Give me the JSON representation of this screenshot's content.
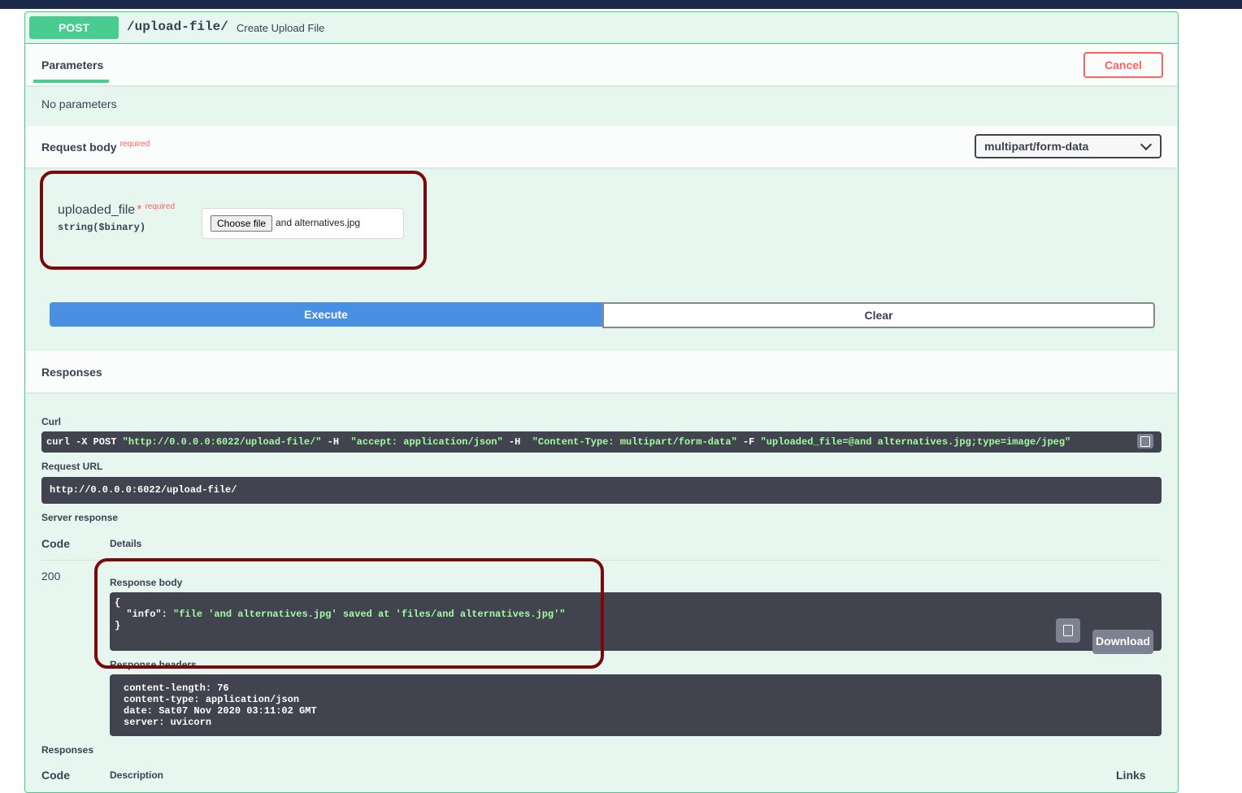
{
  "operation": {
    "method": "POST",
    "path": "/upload-file/",
    "summary": "Create Upload File"
  },
  "parameters": {
    "tab_label": "Parameters",
    "cancel_label": "Cancel",
    "empty_text": "No parameters"
  },
  "request_body": {
    "title": "Request body",
    "required_label": "required",
    "content_type": "multipart/form-data",
    "field": {
      "name": "uploaded_file",
      "star": "*",
      "required_label": "required",
      "type": "string($binary)",
      "choose_label": "Choose file",
      "file_name": "and alternatives.jpg"
    }
  },
  "actions": {
    "execute_label": "Execute",
    "clear_label": "Clear"
  },
  "responses_header": "Responses",
  "curl": {
    "label": "Curl",
    "cmd1": "curl -X POST ",
    "url": "\"http://0.0.0.0:6022/upload-file/\"",
    "h1": " -H  ",
    "accept": "\"accept: application/json\"",
    "h2": " -H  ",
    "ctype": "\"Content-Type: multipart/form-data\"",
    "f": " -F ",
    "form": "\"uploaded_file=@and alternatives.jpg;type=image/jpeg\""
  },
  "request_url": {
    "label": "Request URL",
    "value": "http://0.0.0.0:6022/upload-file/"
  },
  "server_response": {
    "label": "Server response",
    "code_header": "Code",
    "details_header": "Details",
    "code": "200",
    "body_label": "Response body",
    "body_line1": "{",
    "body_key": "  \"info\": ",
    "body_value": "\"file 'and alternatives.jpg' saved at 'files/and alternatives.jpg'\"",
    "body_line3": "}",
    "download_label": "Download",
    "headers_label": "Response headers",
    "headers": [
      "content-length: 76",
      "content-type: application/json",
      "date: Sat07 Nov 2020 03:11:02 GMT",
      "server: uvicorn"
    ]
  },
  "responses_table": {
    "label": "Responses",
    "code_header": "Code",
    "description_header": "Description",
    "links_header": "Links"
  }
}
